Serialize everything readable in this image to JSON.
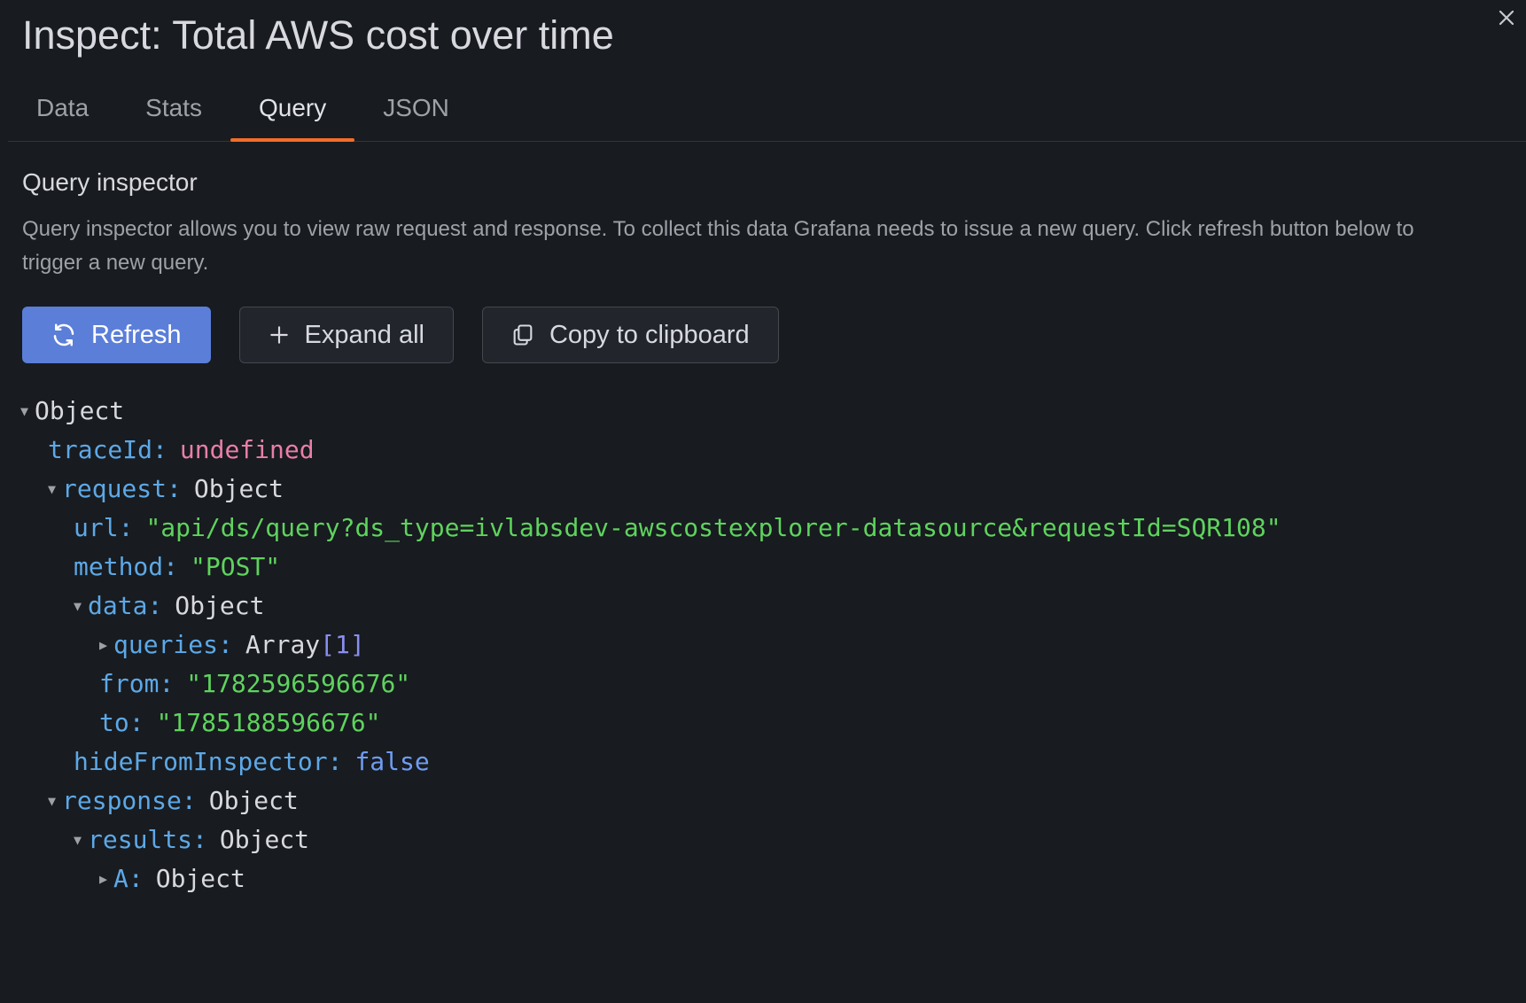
{
  "header": {
    "title": "Inspect: Total AWS cost over time"
  },
  "tabs": [
    {
      "label": "Data",
      "active": false
    },
    {
      "label": "Stats",
      "active": false
    },
    {
      "label": "Query",
      "active": true
    },
    {
      "label": "JSON",
      "active": false
    }
  ],
  "inspector": {
    "title": "Query inspector",
    "description": "Query inspector allows you to view raw request and response. To collect this data Grafana needs to issue a new query. Click refresh button below to trigger a new query."
  },
  "buttons": {
    "refresh": "Refresh",
    "expand_all": "Expand all",
    "copy": "Copy to clipboard"
  },
  "tree": {
    "root": "Object",
    "traceId": {
      "key": "traceId",
      "value": "undefined"
    },
    "request": {
      "key": "request",
      "type": "Object",
      "url": {
        "key": "url",
        "value": "\"api/ds/query?ds_type=ivlabsdev-awscostexplorer-datasource&requestId=SQR108\""
      },
      "method": {
        "key": "method",
        "value": "\"POST\""
      },
      "data": {
        "key": "data",
        "type": "Object",
        "queries": {
          "key": "queries",
          "type": "Array",
          "index": "[1]"
        },
        "from": {
          "key": "from",
          "value": "\"1782596596676\""
        },
        "to": {
          "key": "to",
          "value": "\"1785188596676\""
        }
      },
      "hideFromInspector": {
        "key": "hideFromInspector",
        "value": "false"
      }
    },
    "response": {
      "key": "response",
      "type": "Object",
      "results": {
        "key": "results",
        "type": "Object",
        "A": {
          "key": "A",
          "type": "Object"
        }
      }
    }
  },
  "colors": {
    "background": "#181b1f",
    "primary_button": "#5b7ed8",
    "active_tab_indicator": "#f26d2b",
    "json_key": "#5da8e7",
    "json_string": "#5ed35e",
    "json_undefined": "#e87fa8",
    "json_boolean": "#6f9df3"
  }
}
